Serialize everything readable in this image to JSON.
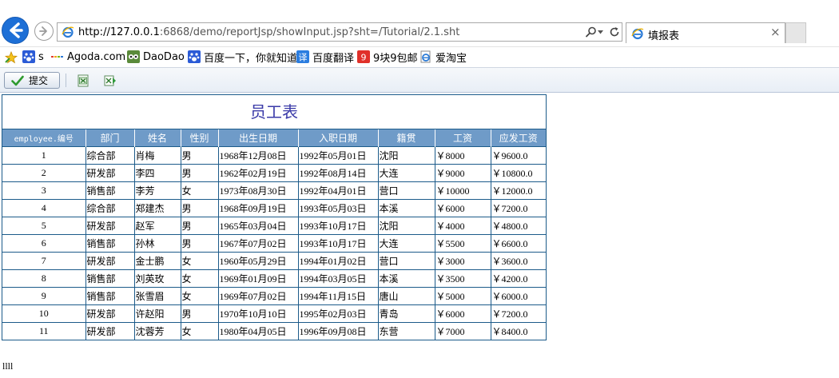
{
  "browser": {
    "url_host": "http://127.0.0.1",
    "url_rest": ":6868/demo/reportJsp/showInput.jsp?sht=/Tutorial/2.1.sht",
    "tab_title": "填报表",
    "tab_close": "×"
  },
  "favorites": [
    {
      "label": "s",
      "icon": "baidu-paw-icon"
    },
    {
      "label": "Agoda.com",
      "icon": "agoda-icon"
    },
    {
      "label": "DaoDao",
      "icon": "daodao-owl-icon"
    },
    {
      "label": "百度一下，你就知道",
      "icon": "baidu-paw-icon"
    },
    {
      "label": "百度翻译",
      "icon": "translate-icon"
    },
    {
      "label": "9块9包邮",
      "icon": "nine-icon"
    },
    {
      "label": "爱淘宝",
      "icon": "ie-page-icon"
    }
  ],
  "toolbar": {
    "submit_label": "提交"
  },
  "report": {
    "title": "员工表",
    "columns": [
      "employee.编号",
      "部门",
      "姓名",
      "性别",
      "出生日期",
      "入职日期",
      "籍贯",
      "工资",
      "应发工资"
    ],
    "rows": [
      [
        "1",
        "综合部",
        "肖梅",
        "男",
        "1968年12月08日",
        "1992年05月01日",
        "沈阳",
        "￥8000",
        "￥9600.0"
      ],
      [
        "2",
        "研发部",
        "李四",
        "男",
        "1962年02月19日",
        "1992年08月14日",
        "大连",
        "￥9000",
        "￥10800.0"
      ],
      [
        "3",
        "销售部",
        "李芳",
        "女",
        "1973年08月30日",
        "1992年04月01日",
        "营口",
        "￥10000",
        "￥12000.0"
      ],
      [
        "4",
        "综合部",
        "郑建杰",
        "男",
        "1968年09月19日",
        "1993年05月03日",
        "本溪",
        "￥6000",
        "￥7200.0"
      ],
      [
        "5",
        "研发部",
        "赵军",
        "男",
        "1965年03月04日",
        "1993年10月17日",
        "沈阳",
        "￥4000",
        "￥4800.0"
      ],
      [
        "6",
        "销售部",
        "孙林",
        "男",
        "1967年07月02日",
        "1993年10月17日",
        "大连",
        "￥5500",
        "￥6600.0"
      ],
      [
        "7",
        "研发部",
        "金士鹏",
        "女",
        "1960年05月29日",
        "1994年01月02日",
        "营口",
        "￥3000",
        "￥3600.0"
      ],
      [
        "8",
        "销售部",
        "刘英玫",
        "女",
        "1969年01月09日",
        "1994年03月05日",
        "本溪",
        "￥3500",
        "￥4200.0"
      ],
      [
        "9",
        "销售部",
        "张雪眉",
        "女",
        "1969年07月02日",
        "1994年11月15日",
        "唐山",
        "￥5000",
        "￥6000.0"
      ],
      [
        "10",
        "研发部",
        "许赵阳",
        "男",
        "1970年10月10日",
        "1995年02月03日",
        "青岛",
        "￥6000",
        "￥7200.0"
      ],
      [
        "11",
        "研发部",
        "沈蓉芳",
        "女",
        "1980年04月05日",
        "1996年09月08日",
        "东营",
        "￥7000",
        "￥8400.0"
      ]
    ]
  },
  "bottom_text": "llll",
  "colors": {
    "header_bg": "#6f9bc8",
    "grid_border": "#1c5b8a",
    "title_color": "#3a3aa8",
    "back_button": "#1d6fd6"
  }
}
